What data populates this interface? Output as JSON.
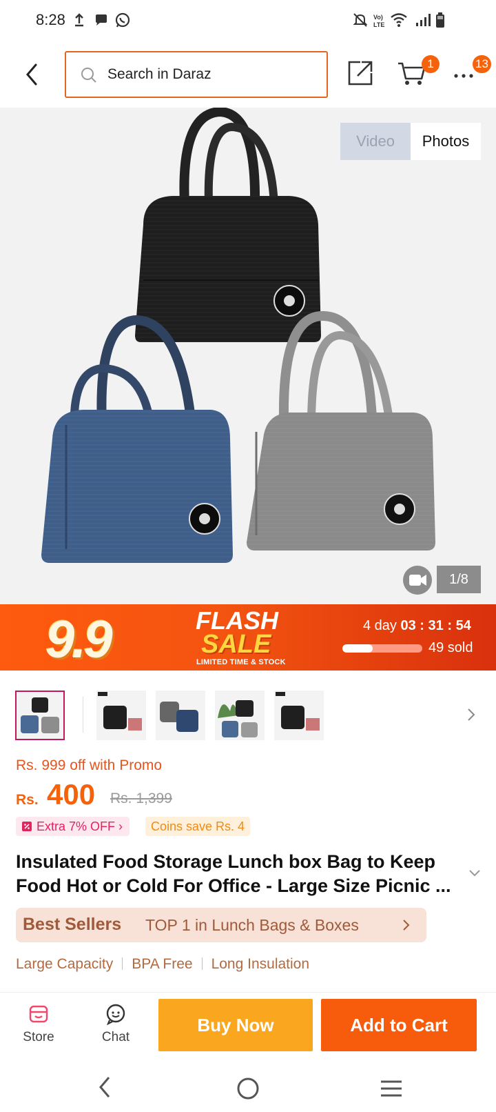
{
  "status_bar": {
    "time": "8:28",
    "icons": [
      "upload-icon",
      "chat-bubble-icon",
      "whatsapp-icon",
      "mute-icon",
      "volte-icon",
      "wifi-icon",
      "signal-icon",
      "battery-icon"
    ],
    "volte_label": "VoLTE"
  },
  "header": {
    "search_placeholder": "Search in Daraz",
    "cart_count": "1",
    "more_count": "13"
  },
  "gallery": {
    "tabs": [
      "Video",
      "Photos"
    ],
    "active_tab": "Photos",
    "counter": "1/8"
  },
  "flash_sale": {
    "event": "9.9",
    "flash": "FLASH",
    "sale": "SALE",
    "tagline": "LIMITED TIME & STOCK",
    "days": "4 day",
    "hours": "03",
    "minutes": "31",
    "seconds": "54",
    "sold_text": "49 sold",
    "sold_progress": 0.38
  },
  "thumbnails": {
    "count_visible": 5,
    "active_index": 0
  },
  "price": {
    "promo": "Rs. 999 off with Promo",
    "currency": "Rs.",
    "current": "400",
    "original": "Rs. 1,399",
    "extra_off": "Extra 7% OFF",
    "coins": "Coins save Rs. 4"
  },
  "product": {
    "title": "Insulated Food Storage Lunch box Bag to Keep Food Hot or Cold For Office - Large Size Picnic ..."
  },
  "best_sellers": {
    "label": "Best Sellers",
    "text": "TOP 1 in Lunch Bags & Boxes"
  },
  "features": [
    "Large Capacity",
    "BPA Free",
    "Long Insulation"
  ],
  "bottom_bar": {
    "store": "Store",
    "chat": "Chat",
    "buy_now": "Buy Now",
    "add_to_cart": "Add to Cart"
  },
  "colors": {
    "accent": "#f4620b",
    "buy_now": "#fba61f",
    "add_to_cart": "#f75b0c",
    "promo_pink": "#e0245e"
  }
}
